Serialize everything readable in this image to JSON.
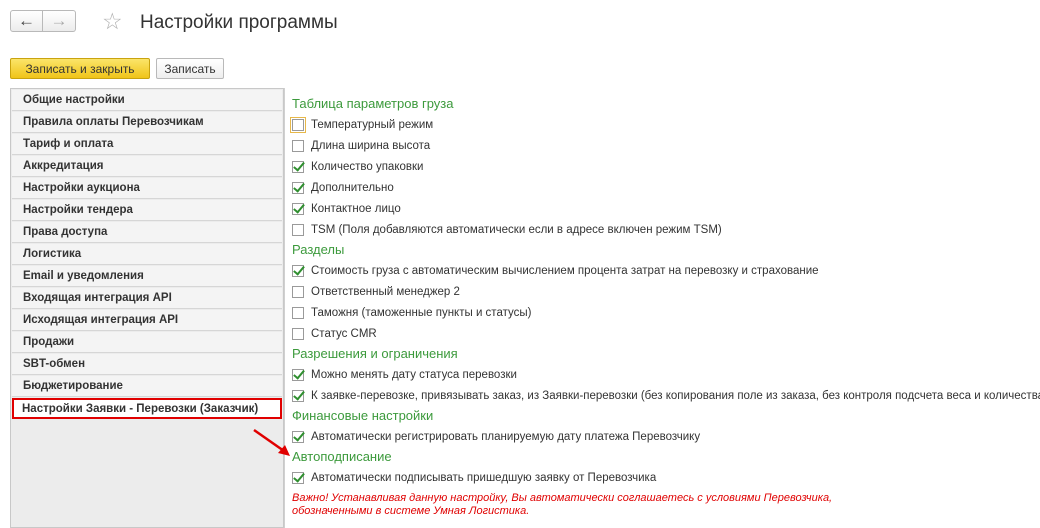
{
  "window": {
    "title": "Настройки программы",
    "back_glyph": "←",
    "forward_glyph": "→",
    "favorite_glyph": "☆"
  },
  "toolbar": {
    "save_close_label": "Записать и закрыть",
    "save_label": "Записать"
  },
  "sidebar": {
    "items": [
      {
        "label": "Общие настройки"
      },
      {
        "label": "Правила оплаты Перевозчикам"
      },
      {
        "label": "Тариф и оплата"
      },
      {
        "label": "Аккредитация"
      },
      {
        "label": "Настройки аукциона"
      },
      {
        "label": "Настройки тендера"
      },
      {
        "label": "Права доступа"
      },
      {
        "label": "Логистика"
      },
      {
        "label": "Email и уведомления"
      },
      {
        "label": "Входящая интеграция API"
      },
      {
        "label": "Исходящая интеграция API"
      },
      {
        "label": "Продажи"
      },
      {
        "label": "SBT-обмен"
      },
      {
        "label": "Бюджетирование"
      },
      {
        "label": "Настройки Заявки - Перевозки (Заказчик)",
        "active": true
      }
    ]
  },
  "sections": {
    "cargo_params": {
      "title": "Таблица параметров груза",
      "items": [
        {
          "label": "Температурный режим",
          "checked": false
        },
        {
          "label": "Длина ширина высота",
          "checked": false
        },
        {
          "label": "Количество упаковки",
          "checked": true
        },
        {
          "label": "Дополнительно",
          "checked": true
        },
        {
          "label": "Контактное лицо",
          "checked": true
        },
        {
          "label": "TSM (Поля добавляются автоматически если в адресе включен режим TSM)",
          "checked": false
        }
      ]
    },
    "sections_block": {
      "title": "Разделы",
      "items": [
        {
          "label": "Стоимость груза с автоматическим вычислением процента затрат на перевозку и страхование",
          "checked": true
        },
        {
          "label": "Ответственный менеджер 2",
          "checked": false
        },
        {
          "label": "Таможня (таможенные пункты и статусы)",
          "checked": false
        },
        {
          "label": "Статус CMR",
          "checked": false
        }
      ]
    },
    "permissions": {
      "title": "Разрешения и ограничения",
      "items": [
        {
          "label": "Можно менять дату статуса перевозки",
          "checked": true
        },
        {
          "label": "К заявке-перевозке, привязывать заказ, из Заявки-перевозки (без копирования поле из заказа, без контроля подсчета веса и количества)",
          "checked": true
        }
      ]
    },
    "finance": {
      "title": "Финансовые настройки",
      "items": [
        {
          "label": "Автоматически регистрировать планируемую дату платежа Перевозчику",
          "checked": true
        }
      ]
    },
    "autosign": {
      "title": "Автоподписание",
      "items": [
        {
          "label": "Автоматически подписывать пришедшую заявку от Перевозчика",
          "checked": true
        }
      ],
      "warning_line1": "Важно! Устанавливая данную настройку, Вы автоматически соглашаетесь с условиями Перевозчика,",
      "warning_line2": "обозначенными в системе Умная Логистика."
    }
  },
  "colors": {
    "section_title": "#3c9a3c",
    "warning": "#e00000",
    "highlight_border": "#e00000",
    "primary_button": "#f0c419"
  }
}
